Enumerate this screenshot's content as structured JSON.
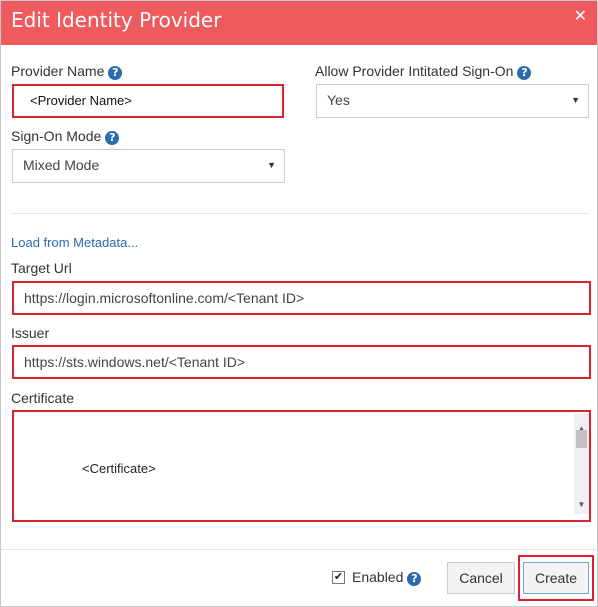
{
  "dialog": {
    "title": "Edit Identity Provider",
    "close_glyph": "✕"
  },
  "form": {
    "provider_name": {
      "label": "Provider Name",
      "value": "<Provider Name>"
    },
    "allow_provider_sign_on": {
      "label": "Allow Provider Intitated Sign-On",
      "value": "Yes"
    },
    "sign_on_mode": {
      "label": "Sign-On Mode",
      "value": "Mixed Mode"
    },
    "load_metadata_link": "Load from Metadata...",
    "target_url": {
      "label": "Target Url",
      "value": "https://login.microsoftonline.com/<Tenant ID>"
    },
    "issuer": {
      "label": "Issuer",
      "value": "https://sts.windows.net/<Tenant ID>"
    },
    "certificate": {
      "label": "Certificate",
      "value": "<Certificate>"
    }
  },
  "footer": {
    "enabled_label": "Enabled",
    "enabled_checked": true,
    "cancel_label": "Cancel",
    "create_label": "Create"
  },
  "icons": {
    "help": "question-circle-icon",
    "close": "close-icon",
    "select_caret": "caret-down-icon"
  },
  "colors": {
    "header_bg": "#ee5a5e",
    "highlight": "#d9232e",
    "link": "#2b6cb0"
  }
}
